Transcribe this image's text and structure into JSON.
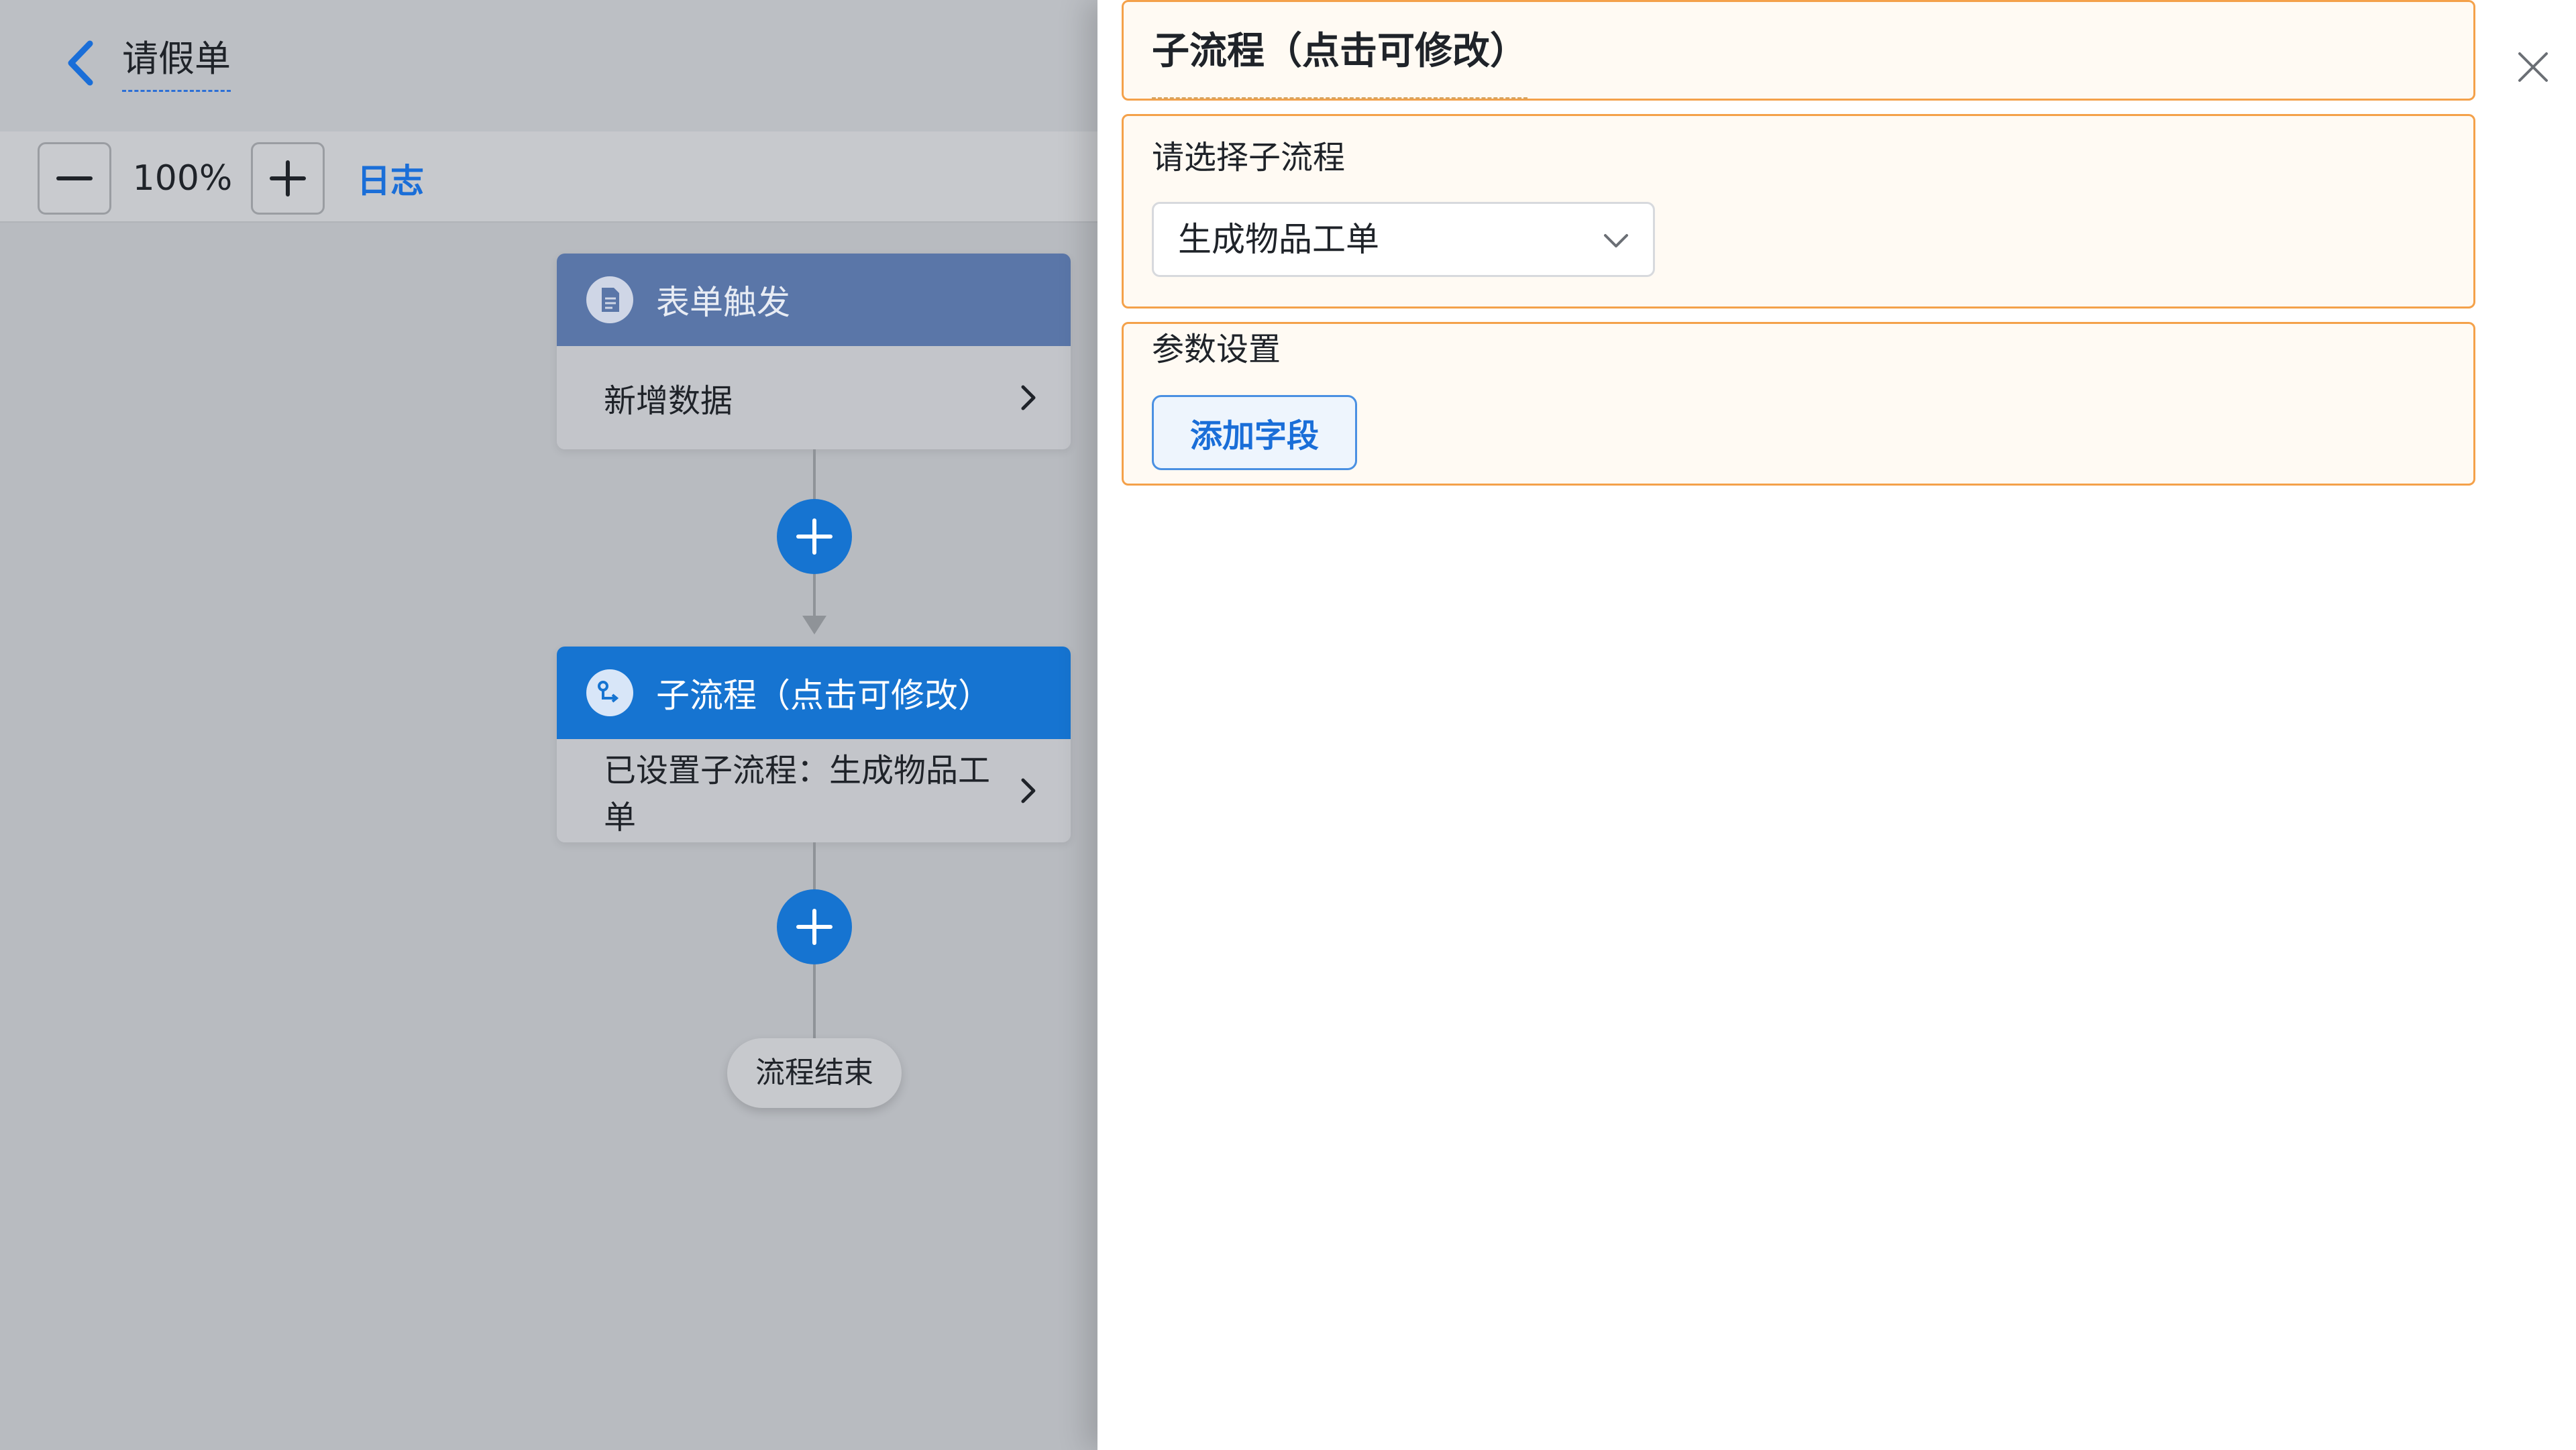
{
  "header": {
    "back_icon": "chevron-left-icon",
    "title": "请假单"
  },
  "toolbar": {
    "zoom_out_icon": "minus-icon",
    "zoom_value": "100%",
    "zoom_in_icon": "plus-icon",
    "log_label": "日志"
  },
  "flow": {
    "trigger": {
      "icon": "document-icon",
      "title": "表单触发",
      "body": "新增数据",
      "chevron_icon": "chevron-right-icon"
    },
    "add_node_icon": "plus-icon",
    "subprocess": {
      "icon": "subprocess-icon",
      "title": "子流程（点击可修改）",
      "body": "已设置子流程：生成物品工单",
      "chevron_icon": "chevron-right-icon"
    },
    "end_label": "流程结束"
  },
  "panel": {
    "title": "子流程（点击可修改）",
    "close_icon": "close-icon",
    "subflow_label": "请选择子流程",
    "subflow_selected": "生成物品工单",
    "subflow_caret_icon": "chevron-down-icon",
    "params_label": "参数设置",
    "add_field_label": "添加字段"
  },
  "colors": {
    "accent_blue": "#1674d1",
    "trigger_header": "#5a76a8",
    "highlight_border": "#f4a14a",
    "link_blue": "#1a6ed8"
  }
}
